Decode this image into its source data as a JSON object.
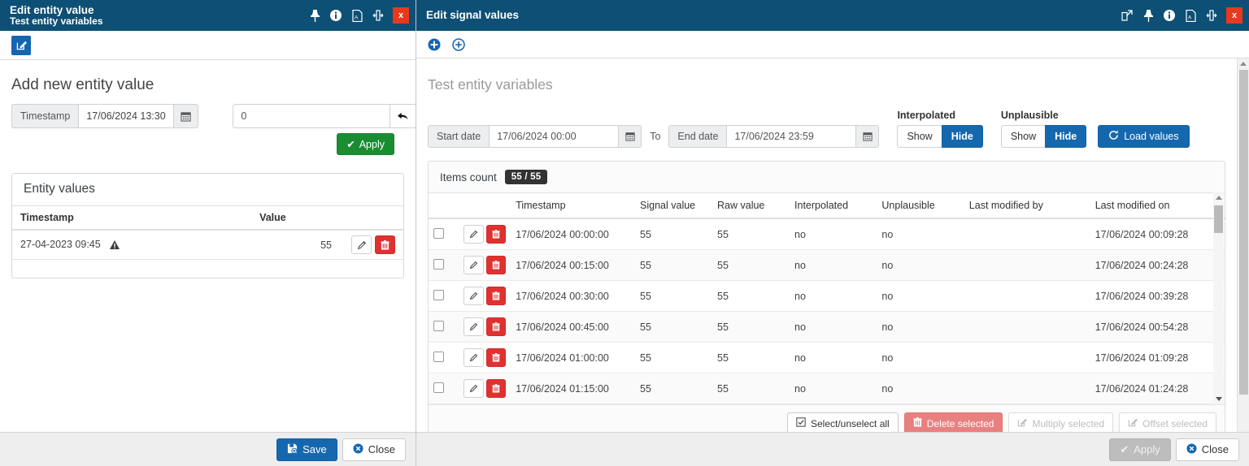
{
  "left_panel": {
    "title": "Edit entity value",
    "subtitle": "Test entity variables",
    "titlebar_icons": [
      "pin-icon",
      "info-icon",
      "pdf-icon",
      "resize-icon",
      "close-icon"
    ],
    "close_label": "x",
    "toolbar": {
      "edit_button_icon": "edit-square-icon"
    },
    "section_title": "Add new entity value",
    "timestamp_addon": "Timestamp",
    "timestamp_value": "17/06/2024 13:30",
    "calendar_icon": "calendar-icon",
    "value_input": "0",
    "undo_icon": "undo-arrow-icon",
    "apply_label": "Apply",
    "entity_values": {
      "card_title": "Entity values",
      "columns": [
        "Timestamp",
        "Value"
      ],
      "rows": [
        {
          "timestamp": "27-04-2023 09:45",
          "warning": true,
          "value": "55"
        }
      ]
    },
    "footer": {
      "save_label": "Save",
      "close_label": "Close"
    }
  },
  "right_panel": {
    "title": "Edit signal values",
    "titlebar_icons": [
      "external-link-icon",
      "pin-icon",
      "info-icon",
      "pdf-icon",
      "resize-icon",
      "close-icon"
    ],
    "close_label": "x",
    "toolbar": {
      "add_icon": "add-filled-circle-icon",
      "add_outline_icon": "add-outline-circle-icon"
    },
    "subtitle": "Test entity variables",
    "filters": {
      "start_addon": "Start date",
      "start_value": "17/06/2024 00:00",
      "to_label": "To",
      "end_addon": "End date",
      "end_value": "17/06/2024 23:59",
      "interpolated_label": "Interpolated",
      "interpolated_show": "Show",
      "interpolated_hide": "Hide",
      "interpolated_selected": "Hide",
      "unplausible_label": "Unplausible",
      "unplausible_show": "Show",
      "unplausible_hide": "Hide",
      "unplausible_selected": "Hide",
      "load_values_label": "Load values",
      "refresh_icon": "refresh-icon"
    },
    "grid": {
      "items_count_label": "Items count",
      "items_count_value": "55 / 55",
      "columns": [
        "",
        "",
        "Timestamp",
        "Signal value",
        "Raw value",
        "Interpolated",
        "Unplausible",
        "Last modified by",
        "Last modified on"
      ],
      "rows": [
        {
          "timestamp": "17/06/2024 00:00:00",
          "signal_value": "55",
          "raw_value": "55",
          "interpolated": "no",
          "unplausible": "no",
          "last_modified_by": "",
          "last_modified_on": "17/06/2024 00:09:28"
        },
        {
          "timestamp": "17/06/2024 00:15:00",
          "signal_value": "55",
          "raw_value": "55",
          "interpolated": "no",
          "unplausible": "no",
          "last_modified_by": "",
          "last_modified_on": "17/06/2024 00:24:28"
        },
        {
          "timestamp": "17/06/2024 00:30:00",
          "signal_value": "55",
          "raw_value": "55",
          "interpolated": "no",
          "unplausible": "no",
          "last_modified_by": "",
          "last_modified_on": "17/06/2024 00:39:28"
        },
        {
          "timestamp": "17/06/2024 00:45:00",
          "signal_value": "55",
          "raw_value": "55",
          "interpolated": "no",
          "unplausible": "no",
          "last_modified_by": "",
          "last_modified_on": "17/06/2024 00:54:28"
        },
        {
          "timestamp": "17/06/2024 01:00:00",
          "signal_value": "55",
          "raw_value": "55",
          "interpolated": "no",
          "unplausible": "no",
          "last_modified_by": "",
          "last_modified_on": "17/06/2024 01:09:28"
        },
        {
          "timestamp": "17/06/2024 01:15:00",
          "signal_value": "55",
          "raw_value": "55",
          "interpolated": "no",
          "unplausible": "no",
          "last_modified_by": "",
          "last_modified_on": "17/06/2024 01:24:28"
        }
      ],
      "actions": {
        "select_all_label": "Select/unselect all",
        "delete_selected_label": "Delete selected",
        "multiply_selected_label": "Multiply selected",
        "offset_selected_label": "Offset selected"
      }
    },
    "footer": {
      "apply_label": "Apply",
      "close_label": "Close"
    }
  },
  "colors": {
    "titlebar": "#0d4f75",
    "close_red": "#e8391d",
    "primary_blue": "#1668ae",
    "green": "#1a8d32",
    "delete_red": "#e03131",
    "badge_dark": "#333333"
  }
}
